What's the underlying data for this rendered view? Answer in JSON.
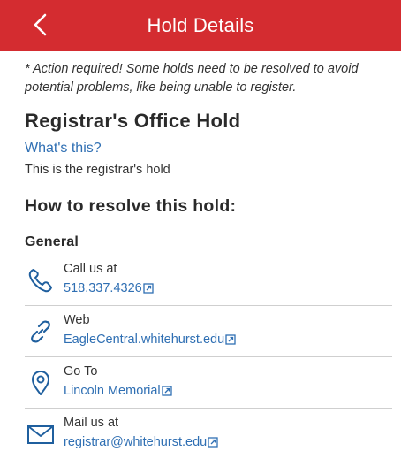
{
  "header": {
    "title": "Hold Details",
    "back_glyph": "<"
  },
  "notice": "* Action required! Some holds need to be resolved to avoid potential problems, like being unable to register.",
  "hold": {
    "title": "Registrar's Office Hold",
    "whats_this": "What's this?",
    "description": "This is the registrar's hold"
  },
  "resolve": {
    "heading": "How to resolve this hold:",
    "section": "General"
  },
  "contacts": [
    {
      "icon": "phone-icon",
      "label": "Call us at",
      "value": "518.337.4326"
    },
    {
      "icon": "link-icon",
      "label": "Web",
      "value": "EagleCentral.whitehurst.edu"
    },
    {
      "icon": "location-pin-icon",
      "label": "Go To",
      "value": "Lincoln Memorial"
    },
    {
      "icon": "envelope-icon",
      "label": "Mail us at",
      "value": "registrar@whitehurst.edu"
    }
  ],
  "colors": {
    "header_bg": "#d42c30",
    "link": "#2f6fb3",
    "icon_blue": "#1f5f9e"
  }
}
